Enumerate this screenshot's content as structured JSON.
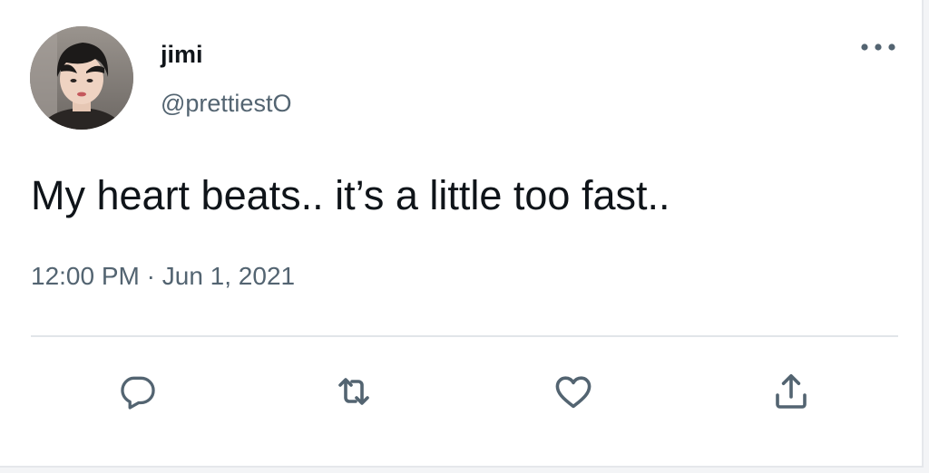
{
  "tweet": {
    "author": {
      "display_name": "jimi",
      "handle": "@prettiestO"
    },
    "text": "My heart beats.. it’s a little too fast..",
    "time": "12:00 PM",
    "separator": "·",
    "date": "Jun 1, 2021"
  },
  "icons": {
    "more": "more-horizontal-icon",
    "reply": "reply-icon",
    "retweet": "retweet-icon",
    "like": "heart-icon",
    "share": "share-icon"
  },
  "colors": {
    "text_primary": "#0f1419",
    "text_secondary": "#536471",
    "divider": "#e1e5e9"
  }
}
